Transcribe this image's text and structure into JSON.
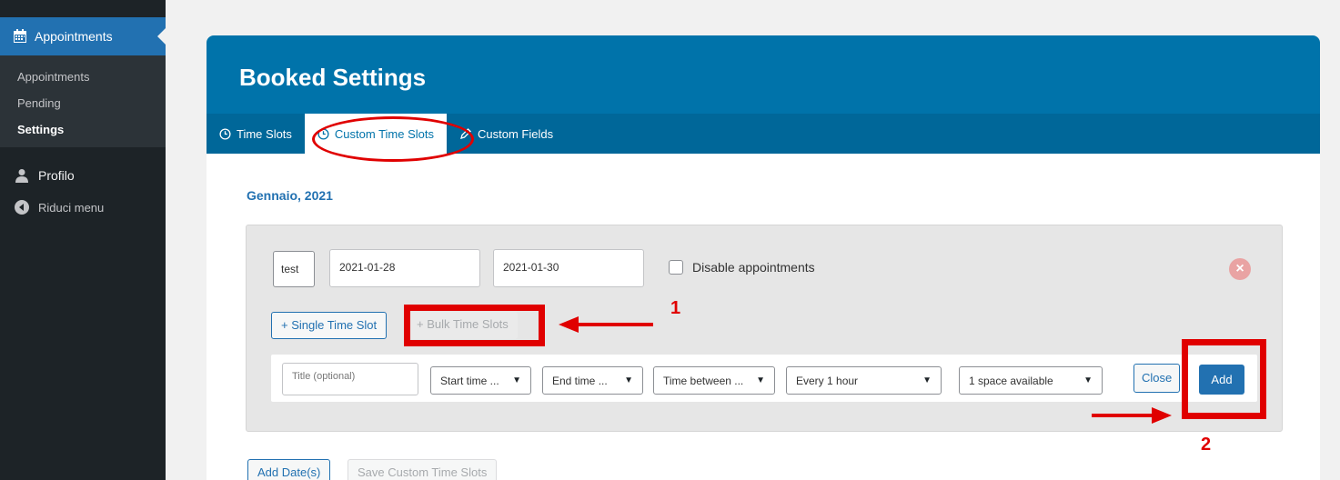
{
  "sidebar": {
    "active_item": "Appointments",
    "submenu": [
      "Appointments",
      "Pending",
      "Settings"
    ],
    "current_submenu": "Settings",
    "profile": "Profilo",
    "collapse": "Riduci menu"
  },
  "page": {
    "title": "Booked Settings",
    "tabs": [
      "Time Slots",
      "Custom Time Slots",
      "Custom Fields"
    ],
    "active_tab": "Custom Time Slots",
    "month": "Gennaio, 2021"
  },
  "custom_slot": {
    "calendar_select": "test",
    "start_date": "2021-01-28",
    "end_date": "2021-01-30",
    "disable_label": "Disable appointments",
    "single_btn": "+ Single Time Slot",
    "bulk_btn": "+ Bulk Time Slots",
    "row": {
      "title_placeholder": "Title (optional)",
      "start_time": "Start time ...",
      "end_time": "End time ...",
      "time_between": "Time between ...",
      "interval": "Every 1 hour",
      "spaces": "1 space available",
      "close": "Close",
      "add": "Add"
    }
  },
  "footer": {
    "add_dates": "Add Date(s)",
    "save": "Save Custom Time Slots"
  },
  "annotations": {
    "one": "1",
    "two": "2",
    "color": "#e00000"
  }
}
